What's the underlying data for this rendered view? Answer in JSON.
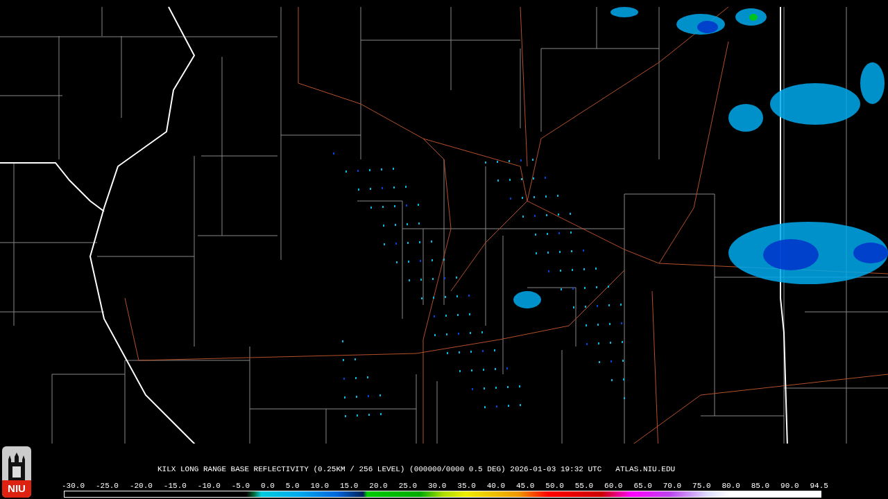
{
  "logo": {
    "text": "NIU"
  },
  "caption": {
    "product": "KILX LONG RANGE BASE REFLECTIVITY (0.25KM / 256 LEVEL) (000000/0000 0.5 DEG) 2026-01-03 19:32 UTC",
    "site": "ATLAS.NIU.EDU"
  },
  "scale": {
    "labels": [
      "-30.0",
      "-25.0",
      "-20.0",
      "-15.0",
      "-10.0",
      "-5.0",
      "0.0",
      "5.0",
      "10.0",
      "15.0",
      "20.0",
      "25.0",
      "30.0",
      "35.0",
      "40.0",
      "45.0",
      "50.0",
      "55.0",
      "60.0",
      "65.0",
      "70.0",
      "75.0",
      "80.0",
      "85.0",
      "90.0",
      "94.5"
    ]
  }
}
